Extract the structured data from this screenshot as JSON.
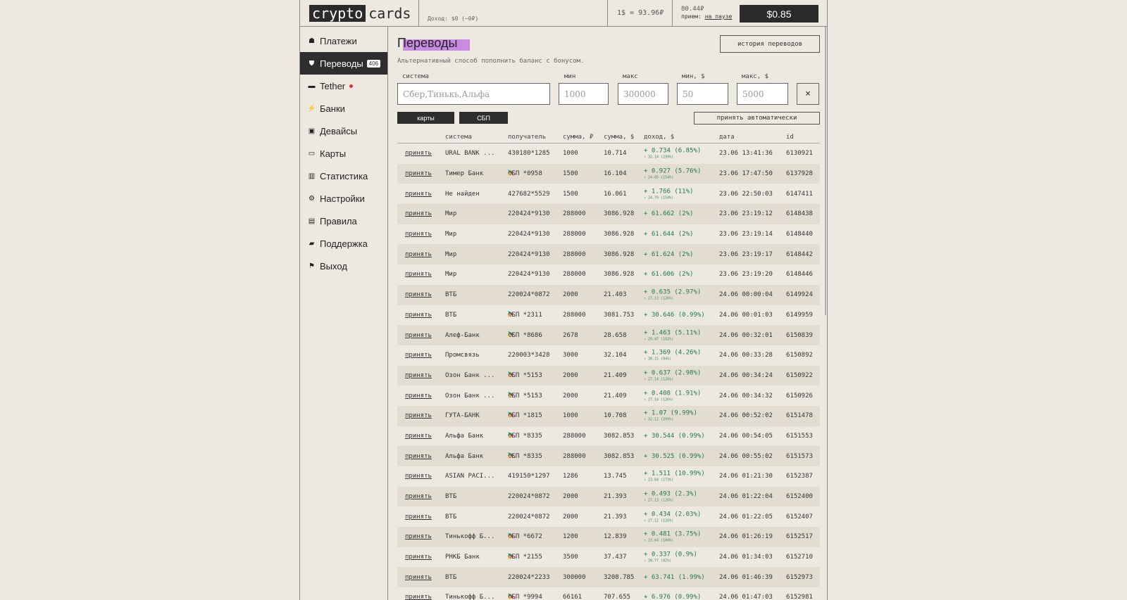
{
  "header": {
    "logo_box": "crypto",
    "logo_rest": "cards",
    "income": "Доход: $0 (~0₽)",
    "rate": "1$ = 93.96₽",
    "balance_rub": "80.44₽",
    "pause_prefix": "прием:",
    "pause_link": "на паузе",
    "balance_usd": "$0.85"
  },
  "sidebar": {
    "items": [
      {
        "icon": "☗",
        "label": "Платежи"
      },
      {
        "icon": "⛊",
        "label": "Переводы",
        "badge": "406"
      },
      {
        "icon": "▬",
        "label": "Tether"
      },
      {
        "icon": "⚡",
        "label": "Банки"
      },
      {
        "icon": "▣",
        "label": "Девайсы"
      },
      {
        "icon": "▭",
        "label": "Карты"
      },
      {
        "icon": "▥",
        "label": "Статистика"
      },
      {
        "icon": "⚙",
        "label": "Настройки"
      },
      {
        "icon": "▤",
        "label": "Правила"
      },
      {
        "icon": "▰",
        "label": "Поддержка"
      },
      {
        "icon": "⚑",
        "label": "Выход"
      }
    ]
  },
  "main": {
    "title": "Переводы",
    "subtitle": "Альтернативный способ пополнить баланс с бонусом.",
    "history_button": "история переводов",
    "filters": {
      "system_label": "система",
      "system_placeholder": "Сбер,Тинькь,Альфа",
      "min_label": "мин",
      "min_placeholder": "1000",
      "max_label": "макс",
      "max_placeholder": "300000",
      "min_usd_label": "мин, $",
      "min_usd_placeholder": "50",
      "max_usd_label": "макс, $",
      "max_usd_placeholder": "5000",
      "clear": "×"
    },
    "btn_cards": "карты",
    "btn_sbp": "СБП",
    "auto_button": "принять автоматически"
  },
  "table": {
    "headers": [
      "система",
      "получатель",
      "сумма, ₽",
      "сумма, $",
      "доход, $",
      "дата",
      "id"
    ],
    "action": "принять",
    "rows": [
      {
        "sys": "URAL BANK ...",
        "sbp": false,
        "rec": "430180*1285",
        "rub": "1000",
        "usd": "10.714",
        "inc": "+ 0.734 (6.85%)",
        "sub": "↑ 32.14 (299%)",
        "date": "23.06 13:41:36",
        "id": "6130921"
      },
      {
        "sys": "Тимер Банк",
        "sbp": true,
        "rec": "СБП *0958",
        "rub": "1500",
        "usd": "16.104",
        "inc": "+ 0.927 (5.76%)",
        "sub": "↑ 24.85 (154%)",
        "date": "23.06 17:47:50",
        "id": "6137928"
      },
      {
        "sys": "Не найден",
        "sbp": false,
        "rec": "427682*5529",
        "rub": "1500",
        "usd": "16.061",
        "inc": "+ 1.766 (11%)",
        "sub": "↑ 24.79 (154%)",
        "date": "23.06 22:50:03",
        "id": "6147411"
      },
      {
        "sys": "Мир",
        "sbp": false,
        "rec": "220424*9130",
        "rub": "288000",
        "usd": "3086.928",
        "inc": "+ 61.662 (2%)",
        "sub": "",
        "date": "23.06 23:19:12",
        "id": "6148438"
      },
      {
        "sys": "Мир",
        "sbp": false,
        "rec": "220424*9130",
        "rub": "288000",
        "usd": "3086.928",
        "inc": "+ 61.644 (2%)",
        "sub": "",
        "date": "23.06 23:19:14",
        "id": "6148440"
      },
      {
        "sys": "Мир",
        "sbp": false,
        "rec": "220424*9130",
        "rub": "288000",
        "usd": "3086.928",
        "inc": "+ 61.624 (2%)",
        "sub": "",
        "date": "23.06 23:19:17",
        "id": "6148442"
      },
      {
        "sys": "Мир",
        "sbp": false,
        "rec": "220424*9130",
        "rub": "288000",
        "usd": "3086.928",
        "inc": "+ 61.606 (2%)",
        "sub": "",
        "date": "23.06 23:19:20",
        "id": "6148446"
      },
      {
        "sys": "ВТБ",
        "sbp": false,
        "rec": "220024*0872",
        "rub": "2000",
        "usd": "21.403",
        "inc": "+ 0.635 (2.97%)",
        "sub": "↑ 27.13 (126%)",
        "date": "24.06 00:00:04",
        "id": "6149924"
      },
      {
        "sys": "ВТБ",
        "sbp": true,
        "rec": "СБП *2311",
        "rub": "288000",
        "usd": "3081.753",
        "inc": "+ 30.646 (0.99%)",
        "sub": "",
        "date": "24.06 00:01:03",
        "id": "6149959"
      },
      {
        "sys": "Алеф-Банк",
        "sbp": true,
        "rec": "СБП *8686",
        "rub": "2678",
        "usd": "28.658",
        "inc": "+ 1.463 (5.11%)",
        "sub": "↑ 29.47 (102%)",
        "date": "24.06 00:32:01",
        "id": "6150839"
      },
      {
        "sys": "Промсвязь",
        "sbp": false,
        "rec": "220003*3428",
        "rub": "3000",
        "usd": "32.104",
        "inc": "+ 1.369 (4.26%)",
        "sub": "↑ 30.15 (94%)",
        "date": "24.06 00:33:28",
        "id": "6150892"
      },
      {
        "sys": "Озон Банк ...",
        "sbp": true,
        "rec": "СБП *5153",
        "rub": "2000",
        "usd": "21.409",
        "inc": "+ 0.637 (2.98%)",
        "sub": "↑ 27.14 (126%)",
        "date": "24.06 00:34:24",
        "id": "6150922"
      },
      {
        "sys": "Озон Банк ...",
        "sbp": true,
        "rec": "СБП *5153",
        "rub": "2000",
        "usd": "21.409",
        "inc": "+ 0.408 (1.91%)",
        "sub": "↑ 27.14 (126%)",
        "date": "24.06 00:34:32",
        "id": "6150926"
      },
      {
        "sys": "ГУТА-БАНК",
        "sbp": true,
        "rec": "СБП *1815",
        "rub": "1000",
        "usd": "10.708",
        "inc": "+ 1.07 (9.99%)",
        "sub": "↑ 32.12 (299%)",
        "date": "24.06 00:52:02",
        "id": "6151478"
      },
      {
        "sys": "Альфа Банк",
        "sbp": true,
        "rec": "СБП *8335",
        "rub": "288000",
        "usd": "3082.853",
        "inc": "+ 30.544 (0.99%)",
        "sub": "",
        "date": "24.06 00:54:05",
        "id": "6151553"
      },
      {
        "sys": "Альфа Банк",
        "sbp": true,
        "rec": "СБП *8335",
        "rub": "288000",
        "usd": "3082.853",
        "inc": "+ 30.525 (0.99%)",
        "sub": "",
        "date": "24.06 00:55:02",
        "id": "6151573"
      },
      {
        "sys": "ASIAN PACI...",
        "sbp": false,
        "rec": "419150*1297",
        "rub": "1286",
        "usd": "13.745",
        "inc": "+ 1.511 (10.99%)",
        "sub": "↑ 23.84 (173%)",
        "date": "24.06 01:21:30",
        "id": "6152387"
      },
      {
        "sys": "ВТБ",
        "sbp": false,
        "rec": "220024*0872",
        "rub": "2000",
        "usd": "21.393",
        "inc": "+ 0.493 (2.3%)",
        "sub": "↑ 27.13 (126%)",
        "date": "24.06 01:22:04",
        "id": "6152400"
      },
      {
        "sys": "ВТБ",
        "sbp": false,
        "rec": "220024*0872",
        "rub": "2000",
        "usd": "21.393",
        "inc": "+ 0.434 (2.03%)",
        "sub": "↑ 27.12 (126%)",
        "date": "24.06 01:22:05",
        "id": "6152407"
      },
      {
        "sys": "Тинькофф Б...",
        "sbp": true,
        "rec": "СБП *6672",
        "rub": "1200",
        "usd": "12.839",
        "inc": "+ 0.481 (3.75%)",
        "sub": "↑ 23.64 (184%)",
        "date": "24.06 01:26:19",
        "id": "6152517"
      },
      {
        "sys": "РНКБ Банк",
        "sbp": true,
        "rec": "СБП *2155",
        "rub": "3500",
        "usd": "37.437",
        "inc": "+ 0.337 (0.9%)",
        "sub": "↑ 30.77 (82%)",
        "date": "24.06 01:34:03",
        "id": "6152710"
      },
      {
        "sys": "ВТБ",
        "sbp": false,
        "rec": "220024*2233",
        "rub": "300000",
        "usd": "3208.785",
        "inc": "+ 63.741 (1.99%)",
        "sub": "",
        "date": "24.06 01:46:39",
        "id": "6152973"
      },
      {
        "sys": "Тинькофф Б...",
        "sbp": true,
        "rec": "СБП *9994",
        "rub": "66161",
        "usd": "707.655",
        "inc": "+ 6.976 (0.99%)",
        "sub": "",
        "date": "24.06 01:47:03",
        "id": "6152981"
      }
    ]
  }
}
